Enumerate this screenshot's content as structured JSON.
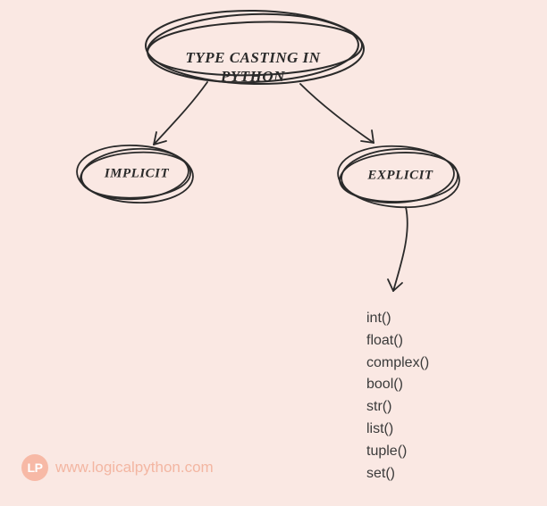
{
  "title": "TYPE CASTING IN PYTHON",
  "children": {
    "left": {
      "label": "IMPLICIT"
    },
    "right": {
      "label": "EXPLICIT",
      "functions": [
        "int()",
        "float()",
        "complex()",
        "bool()",
        "str()",
        "list()",
        "tuple()",
        "set()"
      ]
    }
  },
  "footer": {
    "logo_text": "LP",
    "url": "www.logicalpython.com"
  },
  "colors": {
    "background": "#fae8e3",
    "stroke": "#2a2a2a",
    "accent": "#f3b6a2"
  }
}
